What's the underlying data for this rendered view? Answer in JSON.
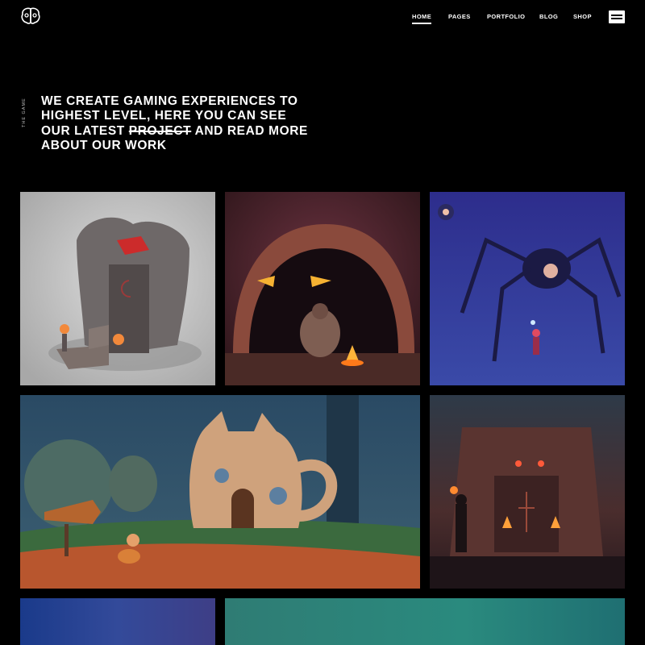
{
  "header": {
    "logo_icon": "brain-logo-icon",
    "nav": [
      {
        "label": "HOME",
        "active": true
      },
      {
        "label": "PAGES",
        "active": false
      },
      {
        "label": "PORTFOLIO",
        "active": false
      },
      {
        "label": "BLOG",
        "active": false
      },
      {
        "label": "SHOP",
        "active": false
      }
    ],
    "menu_icon": "menu-icon"
  },
  "hero": {
    "vertical_label": "THE GAME",
    "headline_before": "WE CREATE GAMING EXPERIENCES TO HIGHEST LEVEL, HERE YOU CAN SEE OUR LATEST",
    "headline_struck": "PROJECT",
    "headline_after": "AND READ MORE ABOUT OUR WORK"
  },
  "portfolio": {
    "items": [
      {
        "scene": "stone-serpent-shrine",
        "bg": "#c8c8c8"
      },
      {
        "scene": "cave-with-glowing-eyes",
        "bg": "#3a1c22"
      },
      {
        "scene": "giant-spider-in-fog",
        "bg": "#3a3aa0"
      },
      {
        "scene": "teapot-house-village",
        "bg": "#2c4d63"
      },
      {
        "scene": "temple-gate-explorer",
        "bg": "#3a2424"
      },
      {
        "scene": "blue-gradient-scene",
        "bg": "#2a4a8a"
      },
      {
        "scene": "teal-gradient-scene",
        "bg": "#2a8a80"
      }
    ]
  },
  "colors": {
    "background": "#000000",
    "text": "#ffffff"
  }
}
